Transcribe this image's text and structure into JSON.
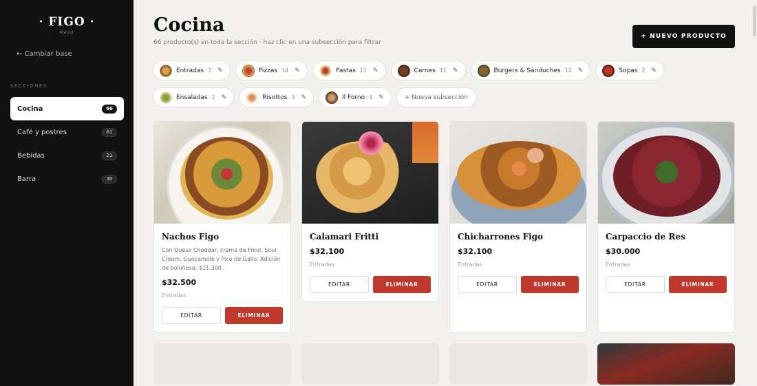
{
  "brand": {
    "name": "· FIGO ·",
    "sub": "Menú"
  },
  "sidebar": {
    "back_label": "← Cambiar base",
    "sections_heading": "SECCIONES",
    "items": [
      {
        "label": "Cocina",
        "count": "66"
      },
      {
        "label": "Café y postres",
        "count": "61"
      },
      {
        "label": "Bebidas",
        "count": "21"
      },
      {
        "label": "Barra",
        "count": "30"
      }
    ]
  },
  "header": {
    "title": "Cocina",
    "subtitle": "66 producto(s) en toda la sección · haz clic en una subsección para filtrar",
    "new_button": "+ NUEVO PRODUCTO"
  },
  "subsections": [
    {
      "label": "Entradas",
      "count": "7",
      "edit": "✎"
    },
    {
      "label": "Pizzas",
      "count": "14",
      "edit": "✎"
    },
    {
      "label": "Pastas",
      "count": "11",
      "edit": "✎"
    },
    {
      "label": "Carnes",
      "count": "11",
      "edit": "✎"
    },
    {
      "label": "Burgers & Sánduches",
      "count": "12",
      "edit": "✎"
    },
    {
      "label": "Sopas",
      "count": "2",
      "edit": "✎"
    },
    {
      "label": "Ensaladas",
      "count": "2",
      "edit": "✎"
    },
    {
      "label": "Risottos",
      "count": "3",
      "edit": "✎"
    },
    {
      "label": "Il Forno",
      "count": "4",
      "edit": "✎"
    }
  ],
  "add_subsection": "+ Nueva subsección",
  "products": [
    {
      "name": "Nachos Figo",
      "description": "Con Queso Cheddar, crema de Frijol, Sour Cream, Guacamole y Pico de Gallo. Adición de boloñesa: $11.300",
      "price": "$32.500",
      "category": "Entradas",
      "edit_label": "EDITAR",
      "delete_label": "ELIMINAR"
    },
    {
      "name": "Calamari Fritti",
      "description": "",
      "price": "$32.100",
      "category": "Entradas",
      "edit_label": "EDITAR",
      "delete_label": "ELIMINAR"
    },
    {
      "name": "Chicharrones Figo",
      "description": "",
      "price": "$32.100",
      "category": "Entradas",
      "edit_label": "EDITAR",
      "delete_label": "ELIMINAR"
    },
    {
      "name": "Carpaccio de Res",
      "description": "",
      "price": "$30.000",
      "category": "Entradas",
      "edit_label": "EDITAR",
      "delete_label": "ELIMINAR"
    }
  ],
  "colors": {
    "sidebar_bg": "#111111",
    "accent_red": "#c0392b",
    "page_bg": "#f2f1ee"
  }
}
